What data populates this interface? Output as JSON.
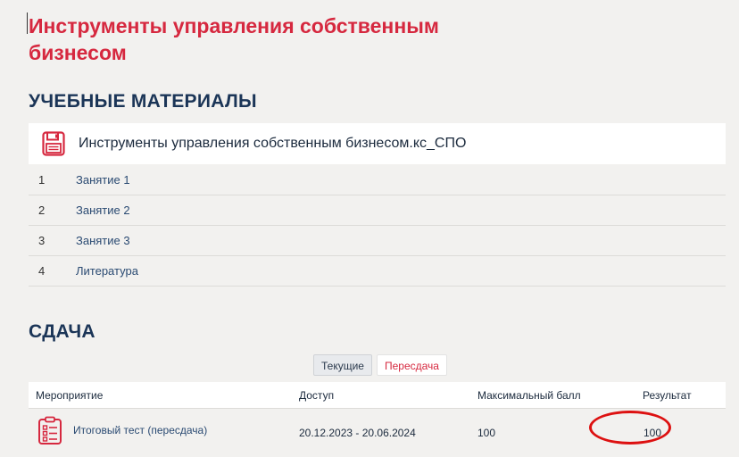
{
  "page": {
    "title": "Инструменты управления собственным бизнесом"
  },
  "materials": {
    "heading": "УЧЕБНЫЕ МАТЕРИАЛЫ",
    "file_title": "Инструменты управления собственным бизнесом.кс_СПО",
    "file_icon": "floppy-disk-icon",
    "items": [
      {
        "num": "1",
        "label": "Занятие 1"
      },
      {
        "num": "2",
        "label": "Занятие 2"
      },
      {
        "num": "3",
        "label": "Занятие 3"
      },
      {
        "num": "4",
        "label": "Литература"
      }
    ]
  },
  "exam": {
    "heading": "СДАЧА",
    "tabs": [
      {
        "label": "Текущие",
        "active": false
      },
      {
        "label": "Пересдача",
        "active": true
      }
    ],
    "columns": [
      "Мероприятие",
      "Доступ",
      "Максимальный балл",
      "Результат"
    ],
    "rows": [
      {
        "icon": "clipboard-list-icon",
        "name": "Итоговый тест (пересдача)",
        "access": "20.12.2023 - 20.06.2024",
        "max_score": "100",
        "result": "100"
      }
    ]
  },
  "colors": {
    "accent": "#d6283f",
    "heading": "#1b3557",
    "link": "#2a4a72",
    "highlight": "#dd1111"
  }
}
